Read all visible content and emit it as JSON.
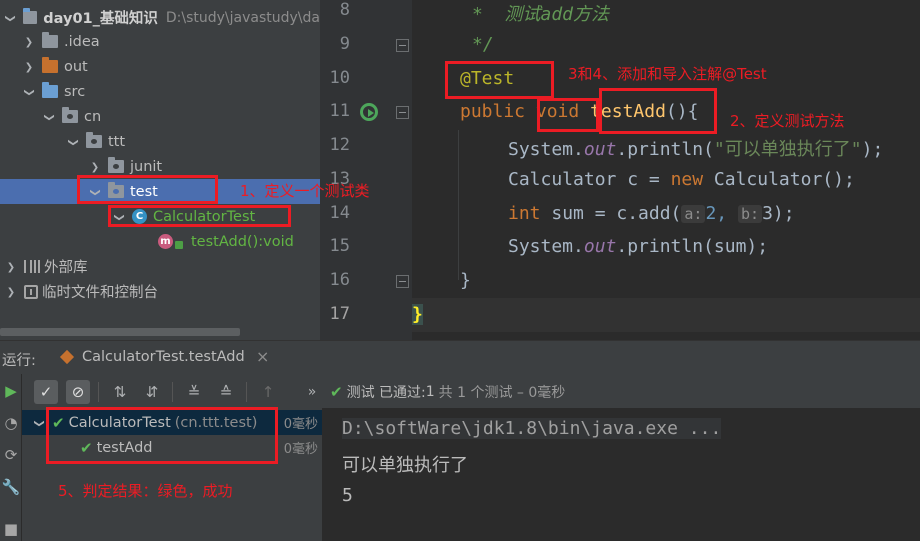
{
  "project_tree": {
    "root": {
      "label": "day01_基础知识",
      "path": "D:\\study\\javastudy\\da"
    },
    "idea": ".idea",
    "out": "out",
    "src": "src",
    "cn": "cn",
    "ttt": "ttt",
    "junit": "junit",
    "test": "test",
    "calculator_test": "CalculatorTest",
    "test_add": "testAdd():void",
    "external_libs": "外部库",
    "scratches": "临时文件和控制台"
  },
  "editor": {
    "line_numbers": [
      "8",
      "9",
      "10",
      "11",
      "12",
      "13",
      "14",
      "15",
      "16",
      "17"
    ],
    "lines": {
      "l8": "*  测试add方法",
      "l9": "*/",
      "l10_annotation": "@Test",
      "l11_public": "public",
      "l11_void": "void",
      "l11_method": "testAdd",
      "l11_rest": "(){",
      "l12_a": "System.",
      "l12_out": "out",
      "l12_b": ".println(",
      "l12_str": "\"可以单独执行了\"",
      "l12_c": ");",
      "l13_a": "Calculator c = ",
      "l13_new": "new",
      "l13_b": " Calculator();",
      "l14_int": "int",
      "l14_a": " sum = c.add(",
      "l14_hint_a": "a:",
      "l14_v1": "2,",
      "l14_hint_b": "b:",
      "l14_v2": "3);",
      "l15_a": "System.",
      "l15_out": "out",
      "l15_b": ".println(sum);",
      "l16": "}",
      "l17": "}"
    }
  },
  "run_panel": {
    "label": "运行:",
    "tab_title": "CalculatorTest.testAdd",
    "tab_close": "×",
    "status_prefix": "测试 已通过:",
    "status_count": "1",
    "status_suffix": "共 1 个测试 – 0毫秒",
    "more": "»",
    "tree": {
      "class_name": "CalculatorTest",
      "class_pkg": "(cn.ttt.test)",
      "class_time": "0毫秒",
      "method_name": "testAdd",
      "method_time": "0毫秒"
    },
    "console": [
      "D:\\softWare\\jdk1.8\\bin\\java.exe ...",
      "可以单独执行了",
      "5"
    ]
  },
  "annotations": {
    "a1": "1、定义一个测试类",
    "a2": "2、定义测试方法",
    "a34": "3和4、添加和导入注解@Test",
    "a5": "5、判定结果：绿色，成功"
  },
  "colors": {
    "keyword": "#cc7832",
    "annotation": "#bbb529",
    "string": "#6a8759",
    "pass_green": "#5fb85a",
    "red_mark": "#ec1c24"
  }
}
